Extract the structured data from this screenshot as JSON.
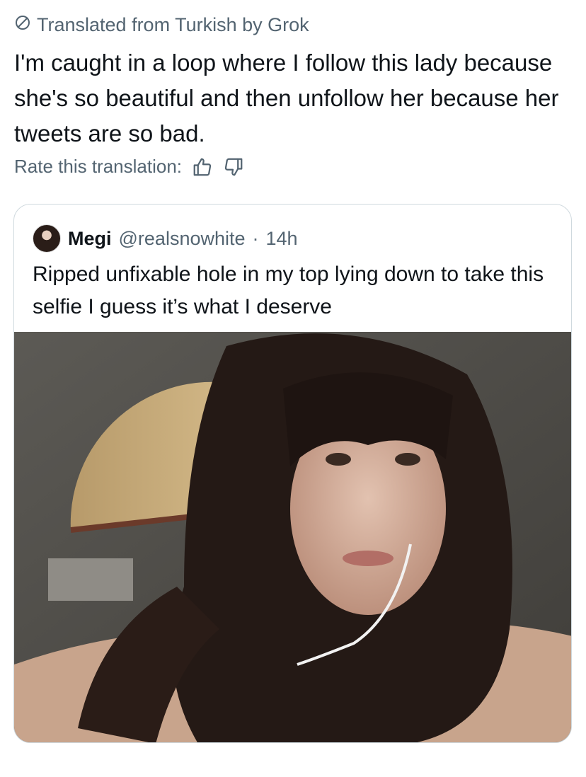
{
  "translation": {
    "label": "Translated from Turkish by Grok",
    "rate_label": "Rate this translation:"
  },
  "tweet": {
    "text": "I'm caught in a loop where I follow this lady because she's so beautiful and then unfollow her because her tweets are so bad."
  },
  "quoted": {
    "name": "Megi",
    "handle": "@realsnowhite",
    "separator": "·",
    "time": "14h",
    "text": "Ripped unfixable hole in my top lying down to take this selfie I guess it’s what I deserve"
  },
  "colors": {
    "text": "#0f1419",
    "secondary": "#536471",
    "border": "#cfd9de"
  },
  "icons": {
    "translate": "grok-slash-circle-icon",
    "thumbs_up": "thumbs-up-icon",
    "thumbs_down": "thumbs-down-icon"
  }
}
